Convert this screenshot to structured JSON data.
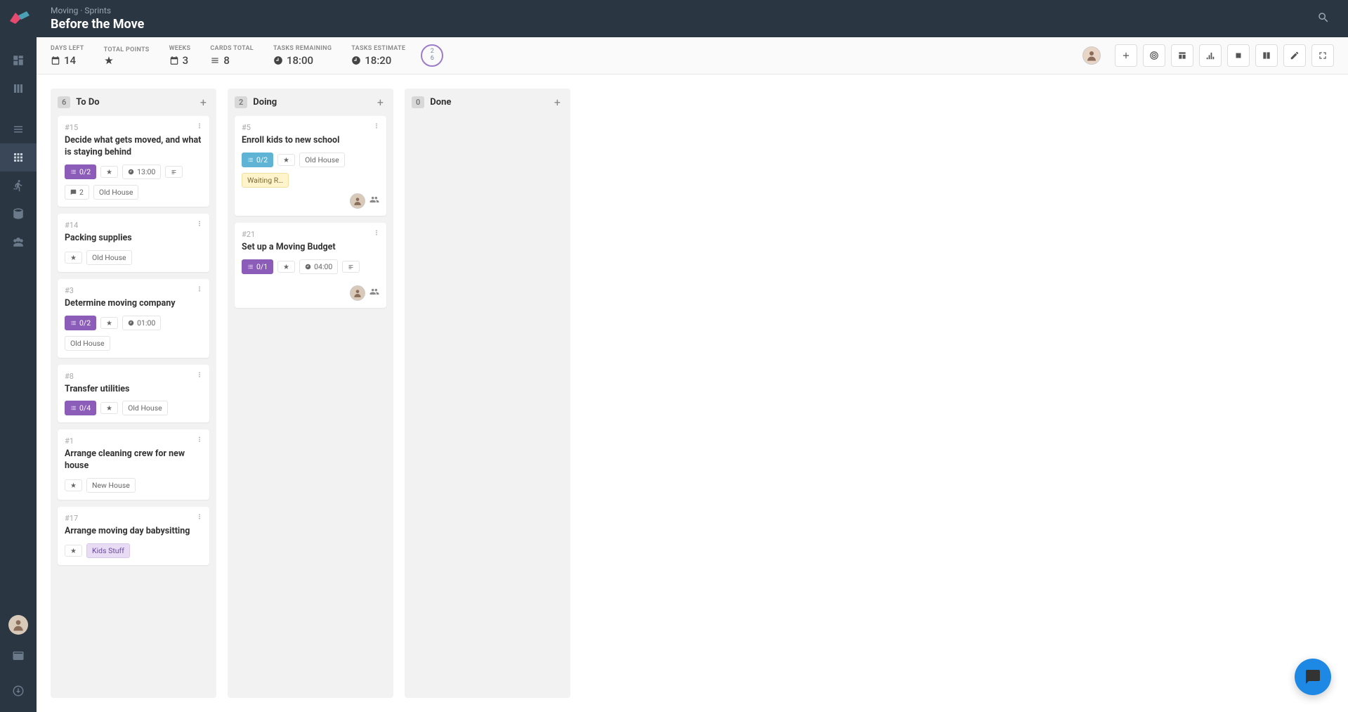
{
  "header": {
    "breadcrumb": "Moving · Sprints",
    "title": "Before the Move"
  },
  "stats": {
    "days_left": {
      "label": "DAYS LEFT",
      "value": "14"
    },
    "total_points": {
      "label": "TOTAL POINTS",
      "value": ""
    },
    "weeks": {
      "label": "WEEKS",
      "value": "3"
    },
    "cards_total": {
      "label": "CARDS TOTAL",
      "value": "8"
    },
    "tasks_remaining": {
      "label": "TASKS REMAINING",
      "value": "18:00"
    },
    "tasks_estimate": {
      "label": "TASKS ESTIMATE",
      "value": "18:20"
    },
    "ring_top": "2",
    "ring_bottom": "6"
  },
  "columns": [
    {
      "count": "6",
      "title": "To Do",
      "cards": [
        {
          "id": "#15",
          "title": "Decide what gets moved, and what is staying behind",
          "tasks": "0/2",
          "tasks_color": "purple",
          "time": "13:00",
          "has_desc": true,
          "has_star": true,
          "comments": "2",
          "tags": [
            "Old House"
          ]
        },
        {
          "id": "#14",
          "title": "Packing supplies",
          "has_star": true,
          "tags": [
            "Old House"
          ]
        },
        {
          "id": "#3",
          "title": "Determine moving company",
          "tasks": "0/2",
          "tasks_color": "purple",
          "time": "01:00",
          "has_star": true,
          "tags": [
            "Old House"
          ]
        },
        {
          "id": "#8",
          "title": "Transfer utilities",
          "tasks": "0/4",
          "tasks_color": "purple",
          "has_star": true,
          "tags": [
            "Old House"
          ]
        },
        {
          "id": "#1",
          "title": "Arrange cleaning crew for new house",
          "has_star": true,
          "tags": [
            "New House"
          ]
        },
        {
          "id": "#17",
          "title": "Arrange moving day babysitting",
          "has_star": true,
          "tags": [
            {
              "text": "Kids Stuff",
              "style": "kids"
            }
          ]
        }
      ]
    },
    {
      "count": "2",
      "title": "Doing",
      "cards": [
        {
          "id": "#5",
          "title": "Enroll kids to new school",
          "tasks": "0/2",
          "tasks_color": "blue",
          "has_star": true,
          "tags": [
            "Old House"
          ],
          "extra_tags": [
            {
              "text": "Waiting R…",
              "style": "waiting"
            }
          ],
          "has_avatar": true,
          "has_group": true
        },
        {
          "id": "#21",
          "title": "Set up a Moving Budget",
          "tasks": "0/1",
          "tasks_color": "purple",
          "time": "04:00",
          "has_desc": true,
          "has_star": true,
          "has_avatar": true,
          "has_group": true
        }
      ]
    },
    {
      "count": "0",
      "title": "Done",
      "cards": []
    }
  ]
}
